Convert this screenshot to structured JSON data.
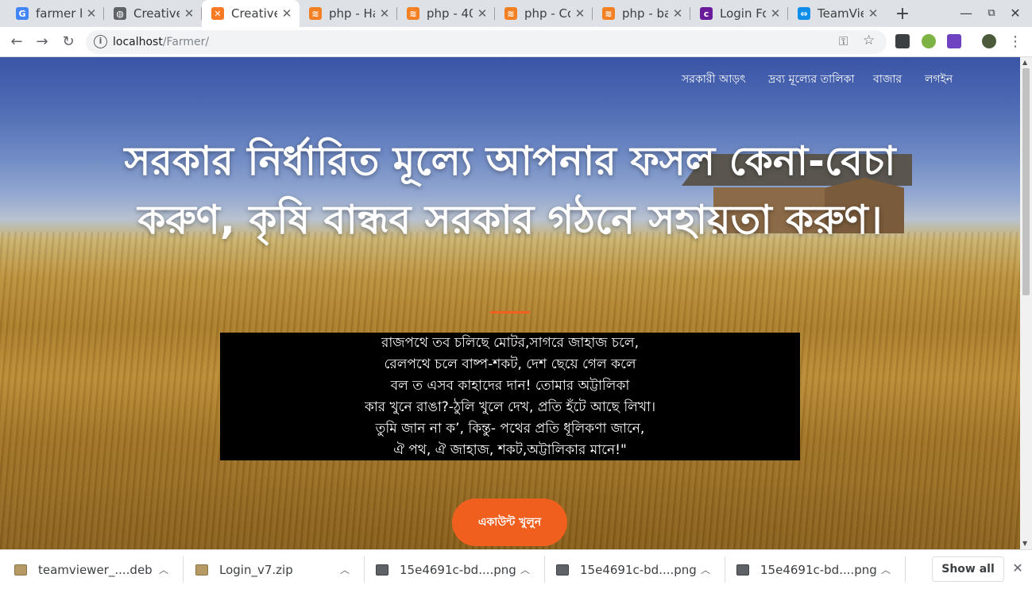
{
  "browser": {
    "tabs": [
      {
        "title": "farmer h",
        "icon": "google-icon",
        "color": "#4285f4",
        "glyph": "G"
      },
      {
        "title": "Creative",
        "icon": "globe-icon",
        "color": "#5f6368",
        "glyph": "◍"
      },
      {
        "title": "Creative",
        "icon": "xampp-icon",
        "color": "#fb7a24",
        "glyph": "✕",
        "active": true
      },
      {
        "title": "php - Ha",
        "icon": "stackoverflow-icon",
        "color": "#f48024",
        "glyph": "≋"
      },
      {
        "title": "php - 404",
        "icon": "stackoverflow-icon",
        "color": "#f48024",
        "glyph": "≋"
      },
      {
        "title": "php - Co",
        "icon": "stackoverflow-icon",
        "color": "#f48024",
        "glyph": "≋"
      },
      {
        "title": "php - bas",
        "icon": "stackoverflow-icon",
        "color": "#f48024",
        "glyph": "≋"
      },
      {
        "title": "Login Fo",
        "icon": "colorlib-icon",
        "color": "#6a1b9a",
        "glyph": "c"
      },
      {
        "title": "TeamVie",
        "icon": "teamviewer-icon",
        "color": "#0e8ee9",
        "glyph": "⇔"
      }
    ],
    "new_tab": "+",
    "window_controls": {
      "minimize": "—",
      "restore": "⧉",
      "close": "✕"
    },
    "url": {
      "host": "localhost",
      "path": "/Farmer/"
    },
    "omnibox_icons": {
      "key": "⚿",
      "star": "☆"
    },
    "menu": "⋮"
  },
  "page": {
    "nav": [
      "সরকারী আড়ৎ",
      "দ্রব্য মূল্যের তালিকা",
      "বাজার",
      "লগইন"
    ],
    "hero_title": "সরকার নির্ধারিত মূল্যে আপনার ফসল কেনা-বেচা করুণ, কৃষি বান্ধব সরকার গঠনে সহায়তা করুণ।",
    "poem": [
      "রাজপথে তব চলিছে মোটর,সাগরে জাহাজ চলে,",
      "রেলপথে চলে বাষ্প-শকট, দেশ ছেয়ে গেল কলে",
      "বল ত এসব কাহাদের দান! তোমার অট্টালিকা",
      "কার খুনে রাঙা?-ঠুলি খুলে দেখ, প্রতি হঁটে আছে লিখা।",
      "তুমি জান না ক’, কিন্তু- পথের প্রতি ধূলিকণা জানে,",
      "ঐ পথ, ঐ জাহাজ, শকট,অট্টালিকার মানে!\""
    ],
    "cta": "একাউন্ট খুলুন",
    "accent": "#f05f1e"
  },
  "downloads": {
    "items": [
      {
        "name": "teamviewer_....deb",
        "type": "zip"
      },
      {
        "name": "Login_v7.zip",
        "type": "zip"
      },
      {
        "name": "15e4691c-bd....png",
        "type": "png"
      },
      {
        "name": "15e4691c-bd....png",
        "type": "png"
      },
      {
        "name": "15e4691c-bd....png",
        "type": "png"
      }
    ],
    "show_all": "Show all",
    "close": "✕"
  }
}
